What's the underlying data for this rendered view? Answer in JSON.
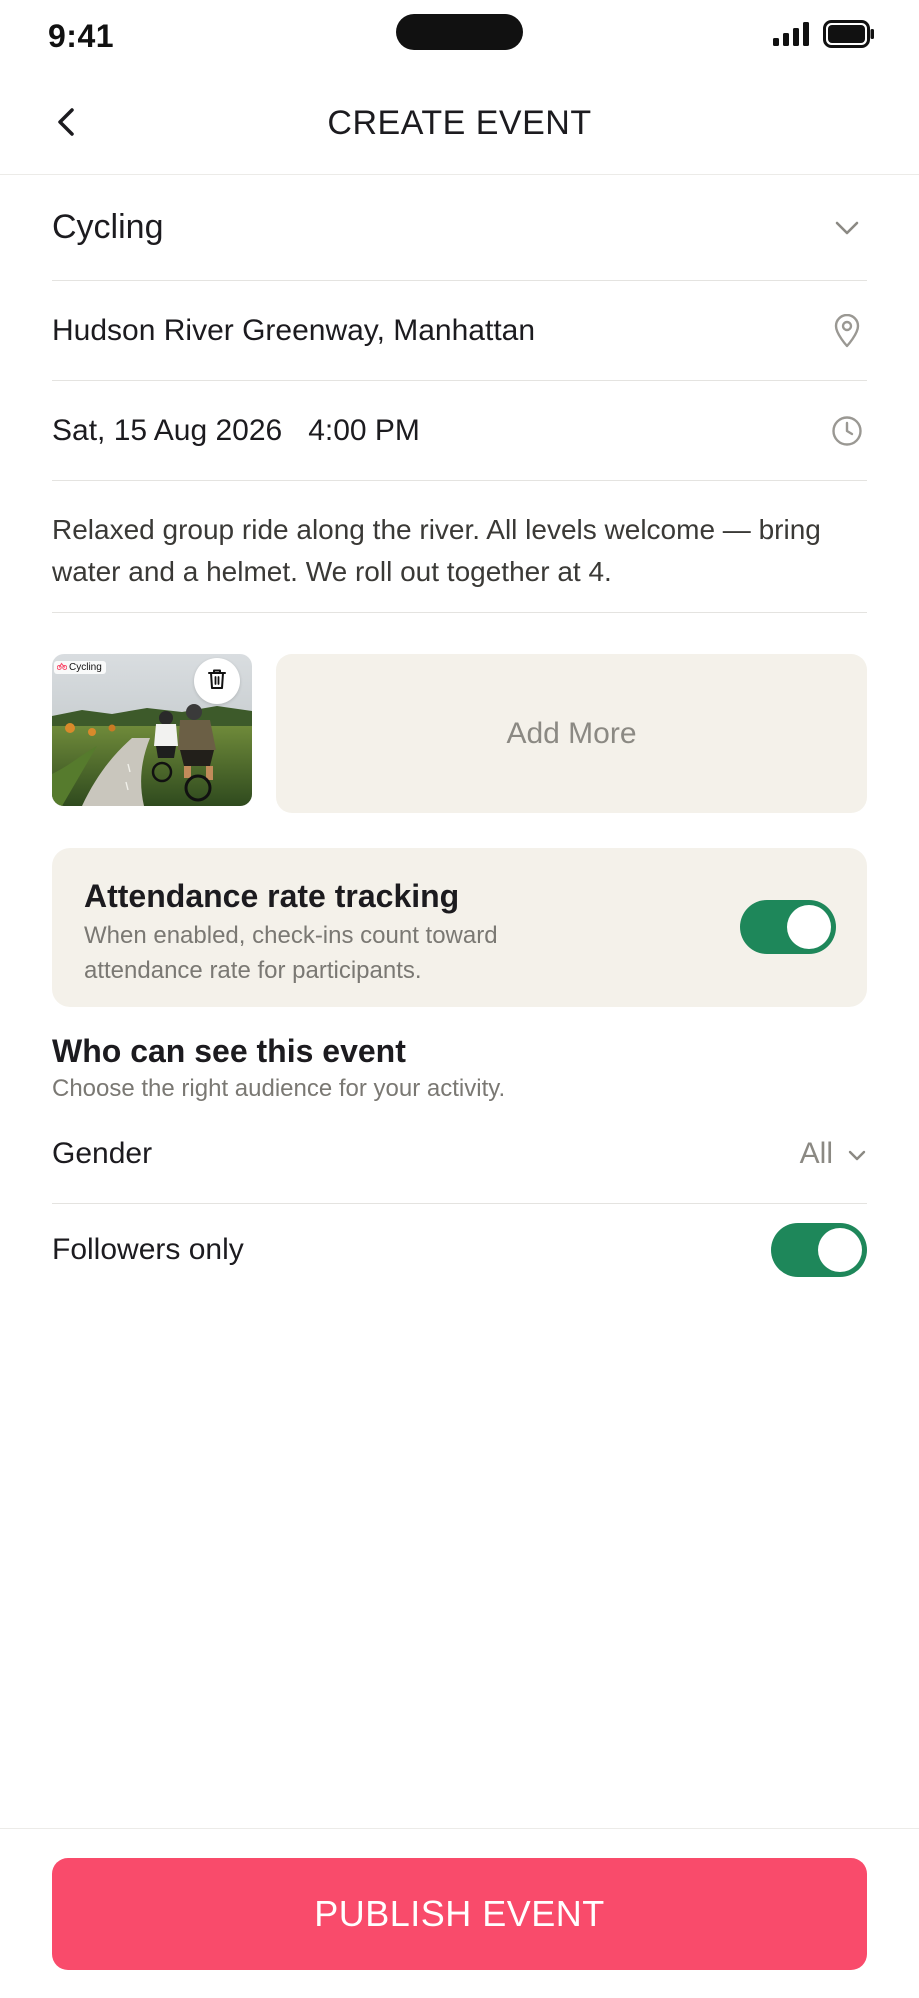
{
  "status_bar": {
    "time": "9:41"
  },
  "header": {
    "title": "CREATE EVENT"
  },
  "form": {
    "activity": "Cycling",
    "location": "Hudson River Greenway, Manhattan",
    "date": "Sat, 15 Aug 2026",
    "time": "4:00 PM",
    "description": "Relaxed group ride along the river. All levels welcome — bring water and a helmet. We roll out together at 4."
  },
  "photos": {
    "thumb_tag": "Cycling",
    "add_more_label": "Add More"
  },
  "attendance": {
    "title": "Attendance rate tracking",
    "description": "When enabled, check-ins count toward attendance rate for participants.",
    "enabled": true
  },
  "visibility": {
    "title": "Who can see this event",
    "subtitle": "Choose the right audience for your activity.",
    "gender_label": "Gender",
    "gender_value": "All",
    "followers_label": "Followers only",
    "followers_enabled": true
  },
  "actions": {
    "publish_label": "PUBLISH EVENT"
  },
  "colors": {
    "accent": "#f94b6b",
    "toggle_on": "#1e875a",
    "card_bg": "#f4f1ea"
  }
}
